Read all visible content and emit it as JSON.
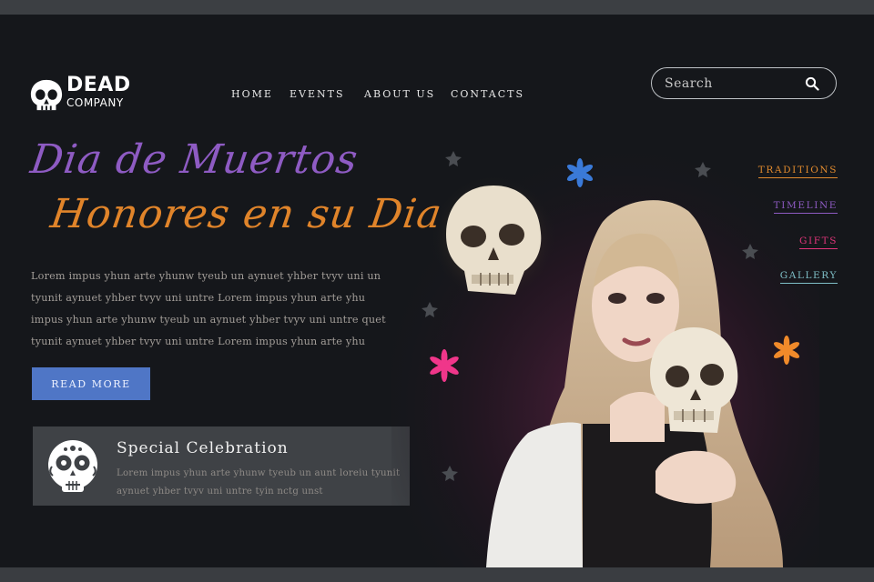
{
  "header": {
    "logo_word": "DEAD",
    "logo_sub": "COMPANY",
    "nav": {
      "home": "HOME",
      "events": "EVENTS",
      "about": "ABOUT US",
      "contacts": "CONTACTS"
    },
    "search": {
      "placeholder": "Search",
      "icon": "search-icon"
    }
  },
  "hero": {
    "title_line1": "Dia de Muertos",
    "title_line2": "Honores en su Dia",
    "body": "Lorem impus yhun arte yhunw tyeub un aynuet yhber tvyv uni un tyunit aynuet yhber tvyv uni untre Lorem impus yhun arte yhu impus yhun arte yhunw tyeub un aynuet yhber tvyv uni untre quet tyunit aynuet yhber tvyv uni untre Lorem impus yhun arte yhu",
    "button": "READ MORE"
  },
  "card": {
    "icon": "sugar-skull-icon",
    "title": "Special Celebration",
    "text": "Lorem impus yhun arte yhunw tyeub un aunt loreiu tyunit aynuet yhber tvyv uni untre tyin nctg unst"
  },
  "side_nav": [
    {
      "label": "TRADITIONS",
      "color": "#e08a2e"
    },
    {
      "label": "TIMELINE",
      "color": "#8e5bc3"
    },
    {
      "label": "GIFTS",
      "color": "#e0357a"
    },
    {
      "label": "GALLERY",
      "color": "#7fc0c8"
    }
  ],
  "colors": {
    "background": "#15171b",
    "purple": "#8e5bc3",
    "orange": "#e0842a",
    "button_blue": "#4f76c6",
    "card_bg": "#3f4246"
  }
}
